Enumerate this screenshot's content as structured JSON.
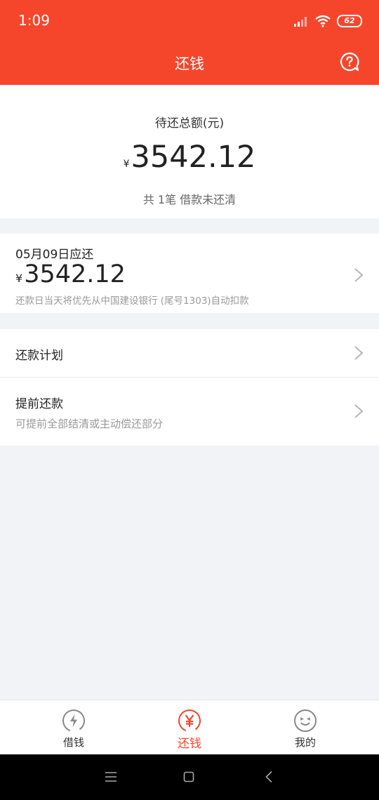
{
  "status": {
    "time": "1:09",
    "battery": "62"
  },
  "header": {
    "title": "还钱"
  },
  "summary": {
    "label": "待还总额(元)",
    "currency": "¥",
    "amount": "3542.12",
    "note": "共 1笔 借款未还清"
  },
  "due": {
    "date": "05月09日应还",
    "currency": "¥",
    "amount": "3542.12",
    "note": "还款日当天将优先从中国建设银行 (尾号1303)自动扣款"
  },
  "menu": {
    "plan": {
      "title": "还款计划"
    },
    "prepay": {
      "title": "提前还款",
      "subtitle": "可提前全部结清或主动偿还部分"
    }
  },
  "tabs": [
    {
      "label": "借钱",
      "icon": "lightning-icon"
    },
    {
      "label": "还钱",
      "icon": "yen-icon"
    },
    {
      "label": "我的",
      "icon": "smile-icon"
    }
  ],
  "colors": {
    "accent": "#f5462c",
    "background": "#f2f3f7"
  }
}
